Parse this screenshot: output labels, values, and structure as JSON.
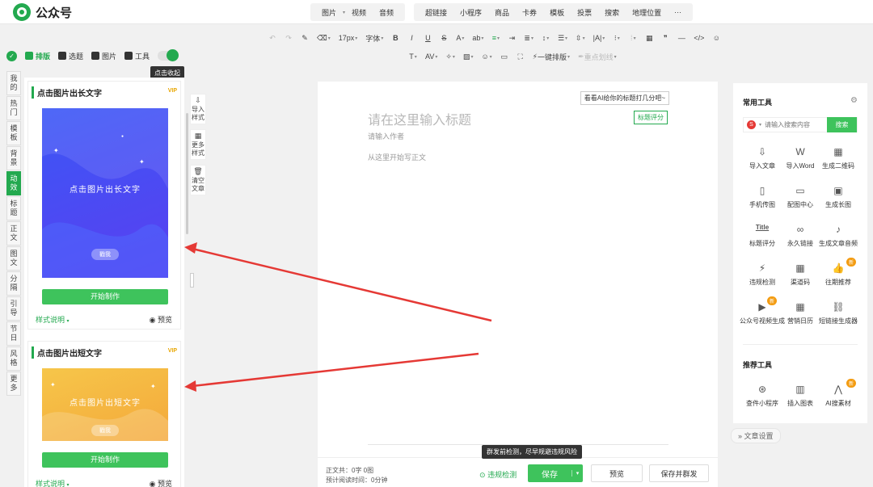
{
  "app": {
    "name": "公众号"
  },
  "top_menu_1": [
    "图片",
    "视频",
    "音频"
  ],
  "top_menu_2": [
    "超链接",
    "小程序",
    "商品",
    "卡券",
    "模板",
    "投票",
    "搜索",
    "地理位置",
    "···"
  ],
  "toolbar": {
    "font_size": "17px",
    "font_family": "字体",
    "one_click_layout": "一键排版",
    "highlight": "重点划线"
  },
  "left_tabs": {
    "layout": "排版",
    "topic": "选题",
    "image": "图片",
    "tool": "工具"
  },
  "collapse_tip": "点击收起",
  "categories": [
    "我的",
    "热门",
    "模板",
    "背景",
    "动效",
    "标题",
    "正文",
    "图文",
    "分隔",
    "引导",
    "节日",
    "风格",
    "更多"
  ],
  "active_category": "动效",
  "cards": [
    {
      "title": "点击图片出长文字",
      "vip": "VIP",
      "poster_text": "点击图片出长文字",
      "pill": "戳我",
      "make": "开始制作",
      "style": "样式说明",
      "preview": "预览"
    },
    {
      "title": "点击图片出短文字",
      "vip": "VIP",
      "poster_text": "点击图片出短文字",
      "pill": "戳我",
      "make": "开始制作",
      "style": "样式说明",
      "preview": "预览"
    }
  ],
  "side_tools": [
    "导入样式",
    "更多样式",
    "清空文章"
  ],
  "editor": {
    "ai_hint": "看看AI给你的标题打几分吧~",
    "score_btn": "标题评分",
    "title_placeholder": "请在这里输入标题",
    "author_placeholder": "请输入作者",
    "body_placeholder": "从这里开始写正文"
  },
  "bottom": {
    "stats_line1": "正文共：0字 0图",
    "stats_line2": "预计阅读时间：0分钟",
    "check": "违规检测",
    "check_tip": "群发前检测，尽早规避违规风险",
    "save": "保存",
    "preview": "预览",
    "save_send": "保存并群发"
  },
  "right_panel": {
    "common_title": "常用工具",
    "search_placeholder": "请输入搜索内容",
    "search_btn": "搜索",
    "tools": [
      {
        "label": "导入文章",
        "icon": "import-icon",
        "glyph": "⇩",
        "badge": ""
      },
      {
        "label": "导入Word",
        "icon": "word-icon",
        "glyph": "W",
        "badge": ""
      },
      {
        "label": "生成二维码",
        "icon": "qrcode-icon",
        "glyph": "▦",
        "badge": ""
      },
      {
        "label": "手机传图",
        "icon": "phone-icon",
        "glyph": "▯",
        "badge": ""
      },
      {
        "label": "配图中心",
        "icon": "image-icon",
        "glyph": "▭",
        "badge": ""
      },
      {
        "label": "生成长图",
        "icon": "long-image-icon",
        "glyph": "▣",
        "badge": ""
      },
      {
        "label": "标题评分",
        "icon": "title-icon",
        "glyph": "Title",
        "badge": ""
      },
      {
        "label": "永久链接",
        "icon": "link-icon",
        "glyph": "∞",
        "badge": ""
      },
      {
        "label": "生成文章音频",
        "icon": "music-icon",
        "glyph": "♪",
        "badge": ""
      },
      {
        "label": "违规检测",
        "icon": "shield-icon",
        "glyph": "⚡",
        "badge": ""
      },
      {
        "label": "渠道码",
        "icon": "channel-code-icon",
        "glyph": "▦",
        "badge": ""
      },
      {
        "label": "往期推荐",
        "icon": "thumb-icon",
        "glyph": "👍",
        "badge": "新"
      },
      {
        "label": "公众号视频生成",
        "icon": "video-icon",
        "glyph": "▶",
        "badge": "新"
      },
      {
        "label": "营销日历",
        "icon": "calendar-icon",
        "glyph": "▦",
        "badge": ""
      },
      {
        "label": "短链接生成器",
        "icon": "short-link-icon",
        "glyph": "⛓",
        "badge": ""
      }
    ],
    "recommend_title": "推荐工具",
    "recommend": [
      {
        "label": "查件小程序",
        "icon": "mini-program-icon",
        "glyph": "⊛",
        "badge": ""
      },
      {
        "label": "插入图表",
        "icon": "chart-icon",
        "glyph": "▥",
        "badge": ""
      },
      {
        "label": "AI搜素材",
        "icon": "ai-icon",
        "glyph": "⋀",
        "badge": "新"
      }
    ],
    "settings": "文章设置"
  },
  "colors": {
    "accent": "#23a94f",
    "arrow": "#e53935",
    "poster1_from": "#3a5cf5",
    "poster2_from": "#f9c12d"
  }
}
